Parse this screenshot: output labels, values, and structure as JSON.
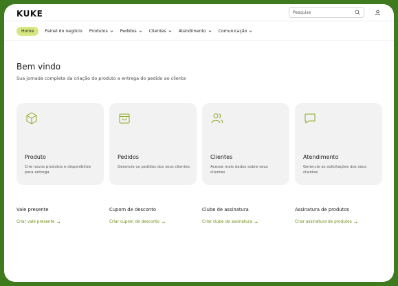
{
  "brand": {
    "logo_text": "KUKE"
  },
  "search": {
    "placeholder": "Pesquise"
  },
  "nav": {
    "items": [
      {
        "label": "Home",
        "active": true
      },
      {
        "label": "Painel do negócio"
      },
      {
        "label": "Produtos"
      },
      {
        "label": "Pedidos"
      },
      {
        "label": "Clientes"
      },
      {
        "label": "Atendimento"
      },
      {
        "label": "Comunicação"
      }
    ]
  },
  "hero": {
    "title": "Bem vindo",
    "subtitle": "Sua jornada completa da criação do produto a entrega do pedido ao cliente"
  },
  "cards": [
    {
      "icon": "box-icon",
      "title": "Produto",
      "desc": "Crie novos produtos e disponibilize para entrega"
    },
    {
      "icon": "bag-icon",
      "title": "Pedidos",
      "desc": "Gerencie os pedidos dos seus clientes"
    },
    {
      "icon": "users-icon",
      "title": "Clientes",
      "desc": "Acesse mais dados sobre seus clientes"
    },
    {
      "icon": "chat-icon",
      "title": "Atendimento",
      "desc": "Gerencie as solicitações dos seus clientes"
    }
  ],
  "links": [
    {
      "title": "Vale presente",
      "cta": "Criar vale presente"
    },
    {
      "title": "Cupom de desconto",
      "cta": "Criar cupom de desconto"
    },
    {
      "title": "Clube de assinatura",
      "cta": "Criar clube de assinatura"
    },
    {
      "title": "Assinatura de produtos",
      "cta": "Criar assinatura de produtos"
    }
  ],
  "colors": {
    "accent": "#d6e680",
    "icon_green": "#8aa81f",
    "link_green": "#6b8f12",
    "card_bg": "#f2f2f2",
    "frame": "#3f7a1f"
  }
}
